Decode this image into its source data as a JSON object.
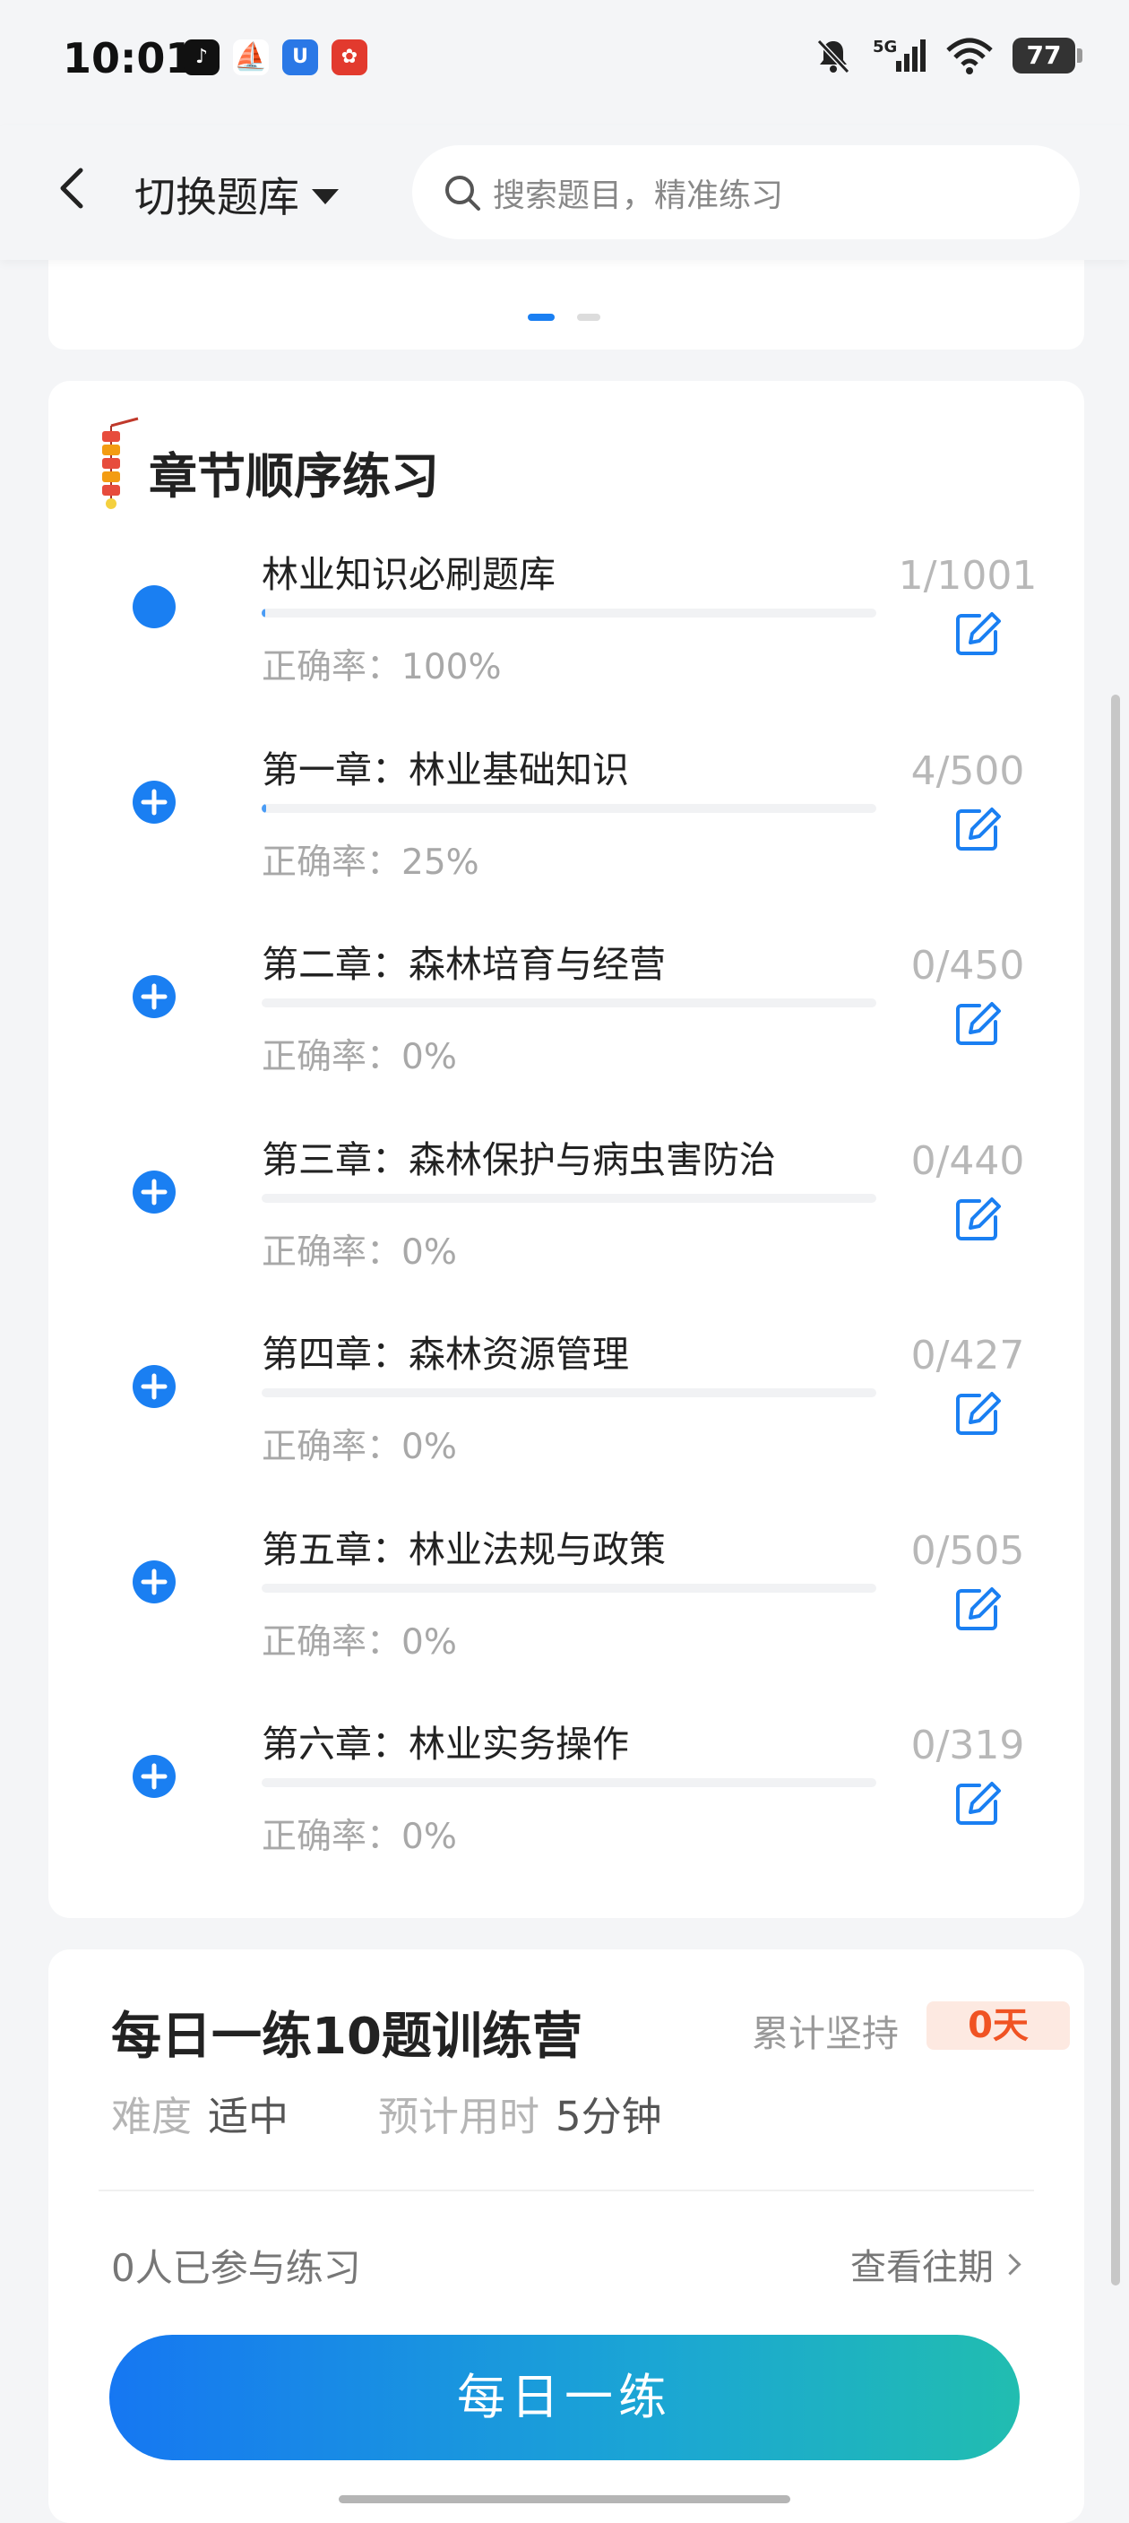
{
  "status_bar": {
    "time": "10:01",
    "apps": [
      {
        "icon": "tiktok-icon",
        "color": "#111111",
        "glyph": "♪"
      },
      {
        "icon": "sailboat-app-icon",
        "color": "#e8432b",
        "glyph": "⛵"
      },
      {
        "icon": "blue-app-icon",
        "color": "#2a78e6",
        "glyph": "U"
      },
      {
        "icon": "red-app-icon",
        "color": "#e23a2e",
        "glyph": "✿"
      }
    ],
    "network": "5G",
    "battery": "77"
  },
  "header": {
    "switch_label": "切换题库",
    "search_placeholder": "搜索题目，精准练习"
  },
  "chapter_section": {
    "title": "章节顺序练习",
    "chapters": [
      {
        "name": "林业知识必刷题库",
        "accuracy": "正确率：100%",
        "count": "1/1001",
        "progress": 0.001,
        "icon": "filled-circle"
      },
      {
        "name": "第一章：林业基础知识",
        "accuracy": "正确率：25%",
        "count": "4/500",
        "progress": 0.008,
        "icon": "plus-circle"
      },
      {
        "name": "第二章：森林培育与经营",
        "accuracy": "正确率：0%",
        "count": "0/450",
        "progress": 0,
        "icon": "plus-circle"
      },
      {
        "name": "第三章：森林保护与病虫害防治",
        "accuracy": "正确率：0%",
        "count": "0/440",
        "progress": 0,
        "icon": "plus-circle"
      },
      {
        "name": "第四章：森林资源管理",
        "accuracy": "正确率：0%",
        "count": "0/427",
        "progress": 0,
        "icon": "plus-circle"
      },
      {
        "name": "第五章：林业法规与政策",
        "accuracy": "正确率：0%",
        "count": "0/505",
        "progress": 0,
        "icon": "plus-circle"
      },
      {
        "name": "第六章：林业实务操作",
        "accuracy": "正确率：0%",
        "count": "0/319",
        "progress": 0,
        "icon": "plus-circle"
      }
    ]
  },
  "daily": {
    "title": "每日一练10题训练营",
    "persist_label": "累计坚持",
    "persist_value": "0天",
    "difficulty_label": "难度",
    "difficulty_value": "适中",
    "time_label": "预计用时",
    "time_value": "5分钟",
    "participants": "0人已参与练习",
    "history_label": "查看往期",
    "button_label": "每日一练"
  },
  "colors": {
    "accent": "#1a7ff2",
    "persist_badge": "#f05323"
  }
}
